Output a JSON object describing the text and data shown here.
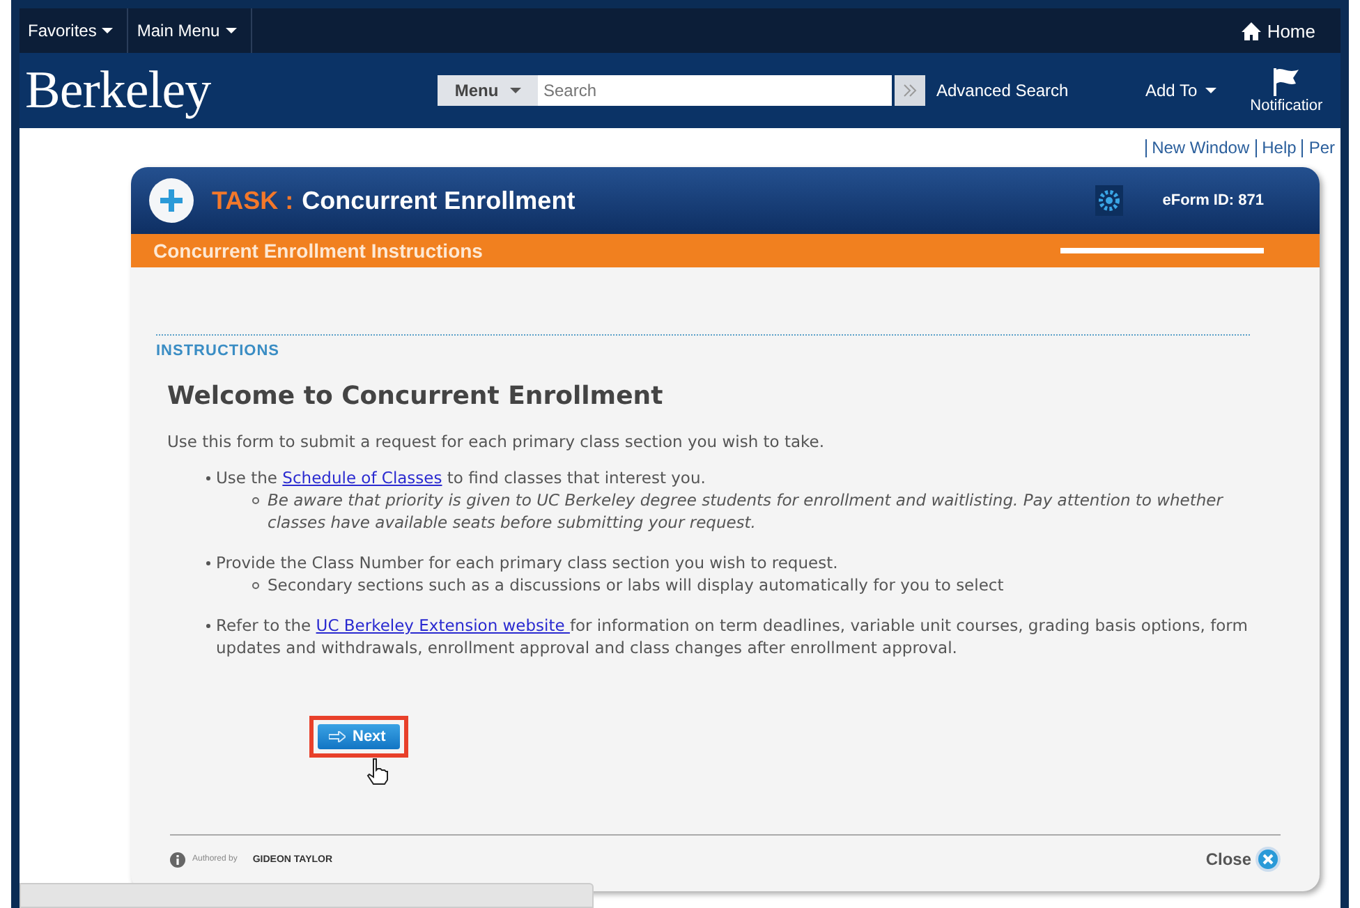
{
  "top_bar": {
    "menus": [
      "Favorites",
      "Main Menu"
    ],
    "home": "Home"
  },
  "header": {
    "logo": "Berkeley",
    "search_menu": "Menu",
    "search": {
      "placeholder": "Search"
    },
    "advanced_search": "Advanced Search",
    "add_to": "Add To",
    "notifications": "Notificatior"
  },
  "utility_links": [
    "New Window",
    "Help",
    "Per"
  ],
  "task": {
    "prefix": "TASK :",
    "title": "Concurrent Enrollment",
    "eform_id": "eForm ID: 871",
    "section": "Concurrent Enrollment Instructions",
    "section_label": "INSTRUCTIONS",
    "heading": "Welcome to Concurrent Enrollment",
    "intro": "Use this form to submit a request for each primary class section you wish to take.",
    "bullets": [
      {
        "before": "Use the ",
        "link": "Schedule of Classes",
        "after": " to find classes that interest you.",
        "sub": "Be aware that priority is given to UC Berkeley degree students for enrollment and waitlisting. Pay attention to whether classes have available seats before submitting your request.",
        "sub_italic": true
      },
      {
        "before": "Provide the Class Number for each primary class section you wish to request.",
        "sub": "Secondary sections such as a discussions or labs will display automatically for you to select",
        "sub_italic": false
      },
      {
        "before": "Refer to the ",
        "link": "UC Berkeley Extension website ",
        "after": "for information on term deadlines, variable unit courses, grading basis options, form updates and withdrawals, enrollment approval and class changes after enrollment approval."
      }
    ],
    "next_button": "Next",
    "next_highlighted": true,
    "authored_by": "Authored by",
    "author": "GIDEON TAYLOR",
    "close": "Close"
  }
}
